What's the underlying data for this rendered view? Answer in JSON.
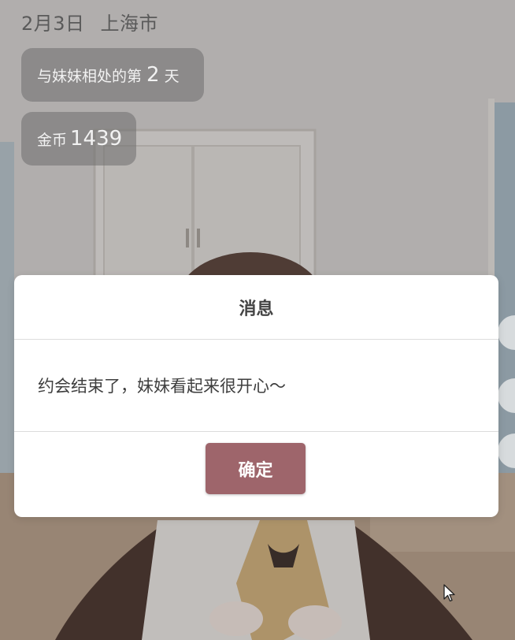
{
  "hud": {
    "date": "2月3日",
    "city": "上海市",
    "days_prefix": "与妹妹相处的第",
    "days_value": "2",
    "days_suffix": "天",
    "coins_label": "金币",
    "coins_value": "1439"
  },
  "dialog": {
    "title": "消息",
    "message": "约会结束了，妹妹看起来很开心～",
    "confirm_label": "确定"
  },
  "colors": {
    "accent": "#9e656b",
    "pill_bg": "#6e6e6e",
    "dialog_bg": "#ffffff"
  },
  "icons": {
    "cursor": "cursor-arrow-icon"
  }
}
